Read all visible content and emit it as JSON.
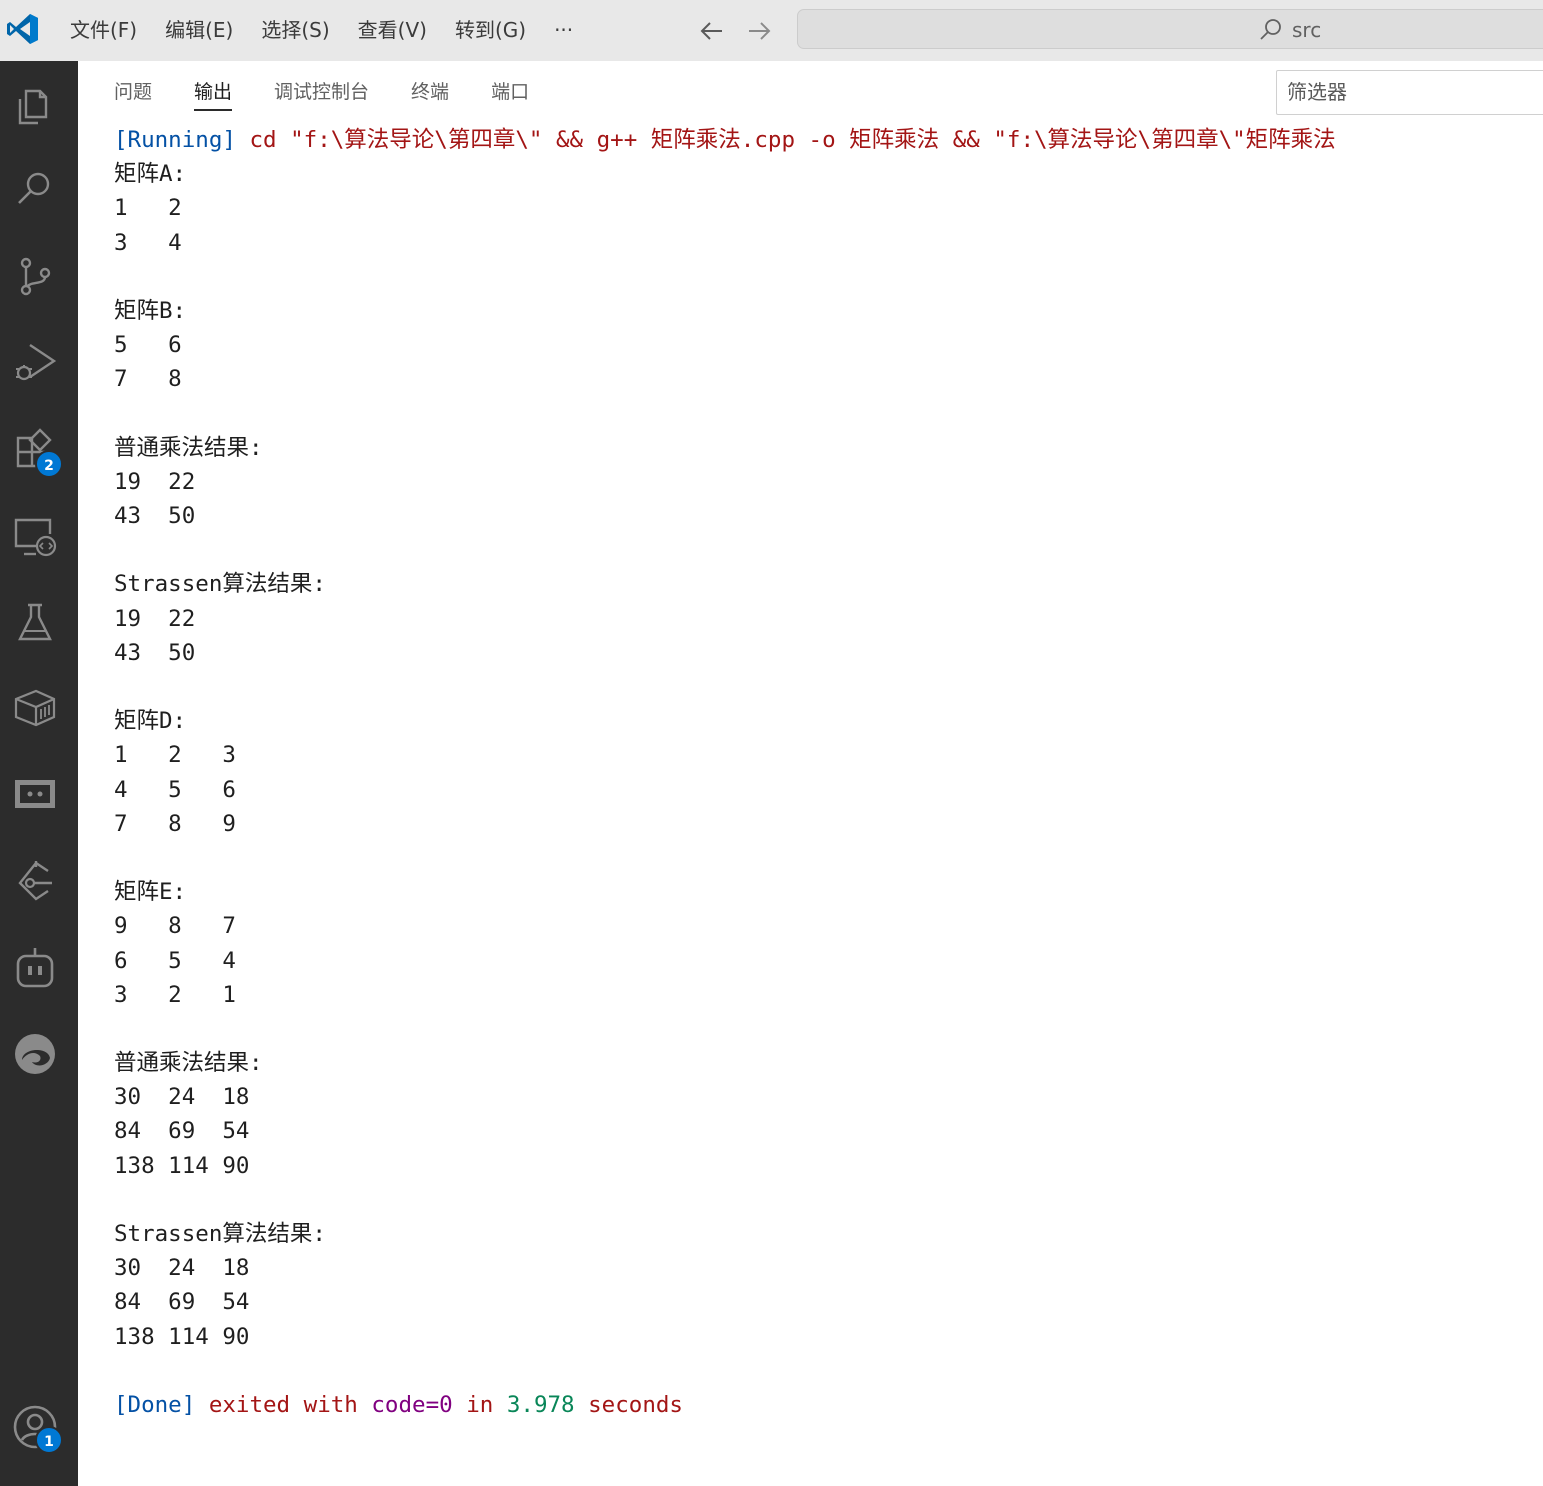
{
  "titlebar": {
    "menu": [
      "文件(F)",
      "编辑(E)",
      "选择(S)",
      "查看(V)",
      "转到(G)",
      "···"
    ],
    "search_text": "src"
  },
  "activitybar": {
    "items": [
      "explorer-icon",
      "search-icon",
      "source-control-icon",
      "run-debug-icon",
      "extensions-icon",
      "remote-explorer-icon",
      "testing-icon",
      "containers-icon",
      "remote-ssh-icon",
      "gitlens-icon",
      "copilot-icon",
      "edge-devtools-icon",
      "accounts-icon"
    ],
    "extensions_badge": "2",
    "accounts_badge": "1",
    "badge_color": "#0078d4"
  },
  "panel": {
    "tabs": [
      "问题",
      "输出",
      "调试控制台",
      "终端",
      "端口"
    ],
    "active_tab": "输出",
    "filter_placeholder": "筛选器"
  },
  "output": {
    "running_tag": "[Running]",
    "running_cmd": " cd \"f:\\算法导论\\第四章\\\" && g++ 矩阵乘法.cpp -o 矩阵乘法 && \"f:\\算法导论\\第四章\\\"矩阵乘法",
    "lines": [
      "矩阵A:",
      "1   2",
      "3   4",
      "",
      "矩阵B:",
      "5   6",
      "7   8",
      "",
      "普通乘法结果:",
      "19  22",
      "43  50",
      "",
      "Strassen算法结果:",
      "19  22",
      "43  50",
      "",
      "矩阵D:",
      "1   2   3",
      "4   5   6",
      "7   8   9",
      "",
      "矩阵E:",
      "9   8   7",
      "6   5   4",
      "3   2   1",
      "",
      "普通乘法结果:",
      "30  24  18",
      "84  69  54",
      "138 114 90",
      "",
      "Strassen算法结果:",
      "30  24  18",
      "84  69  54",
      "138 114 90",
      ""
    ],
    "done_tag": "[Done]",
    "done_exited": " exited with ",
    "done_code": "code=0",
    "done_in": " in ",
    "done_time": "3.978",
    "done_seconds": " seconds"
  }
}
